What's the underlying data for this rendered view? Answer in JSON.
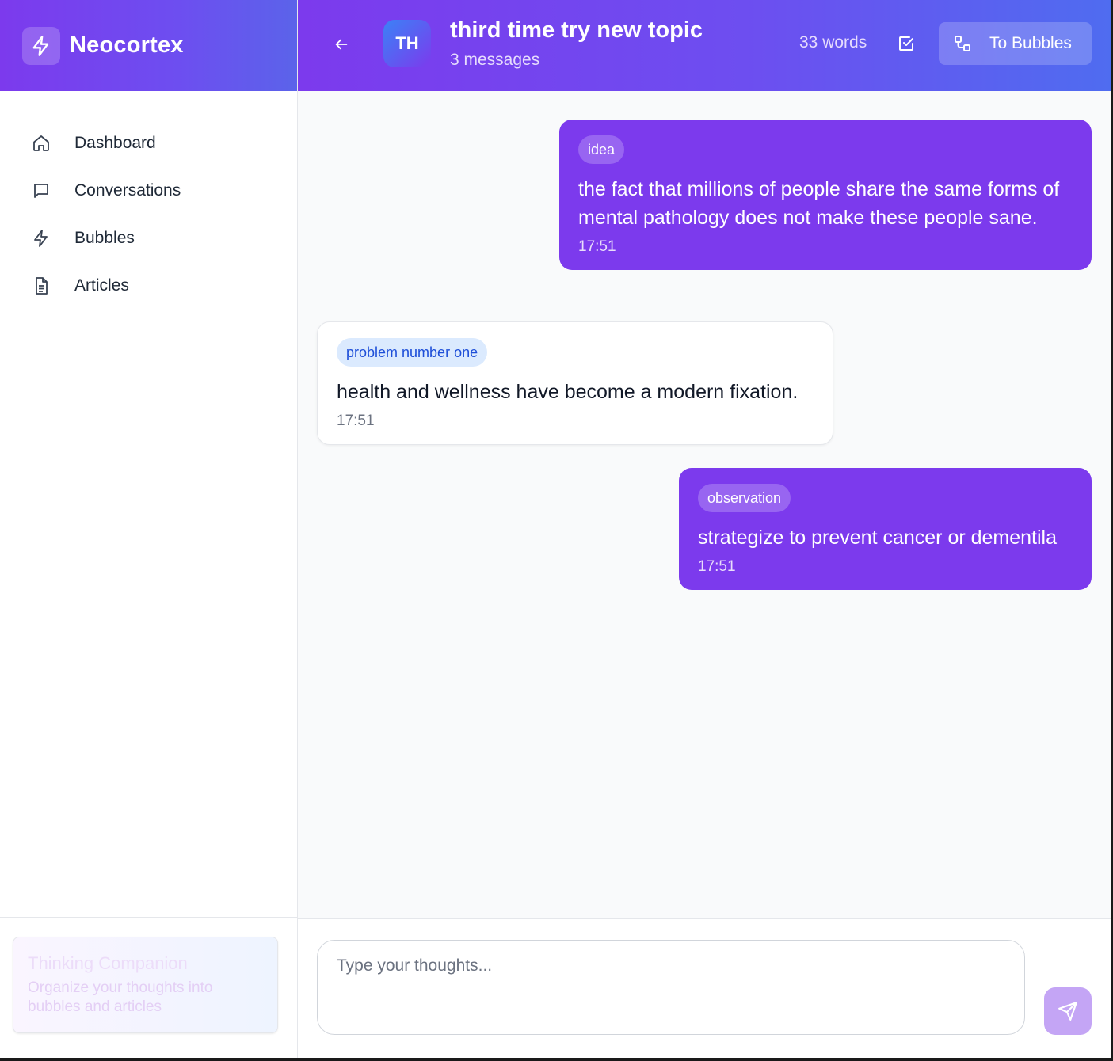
{
  "app": {
    "name": "Neocortex"
  },
  "sidebar": {
    "items": [
      {
        "label": "Dashboard",
        "icon": "home-icon"
      },
      {
        "label": "Conversations",
        "icon": "message-square-icon"
      },
      {
        "label": "Bubbles",
        "icon": "zap-icon"
      },
      {
        "label": "Articles",
        "icon": "file-text-icon"
      }
    ],
    "footer": {
      "title": "Thinking Companion",
      "description": "Organize your thoughts into bubbles and articles"
    }
  },
  "header": {
    "avatar_initials": "TH",
    "title": "third time try new topic",
    "subtitle": "3 messages",
    "word_count": "33 words",
    "to_bubbles_label": "To Bubbles"
  },
  "messages": [
    {
      "sender": "user",
      "tag": "idea",
      "text": "the fact that millions of people share the same forms of mental pathology does not make these people sane.",
      "time": "17:51"
    },
    {
      "sender": "other",
      "tag": "problem number one",
      "text": "health and wellness have become a modern fixation.",
      "time": "17:51"
    },
    {
      "sender": "user",
      "tag": "observation",
      "text": "strategize to prevent cancer or dementila",
      "time": "17:51"
    }
  ],
  "composer": {
    "placeholder": "Type your thoughts..."
  },
  "colors": {
    "accent": "#7c3aed",
    "header_gradient_end": "#4f6cf0",
    "tag_blue_bg": "#dbeafe",
    "send_button": "#c4a5f5"
  }
}
